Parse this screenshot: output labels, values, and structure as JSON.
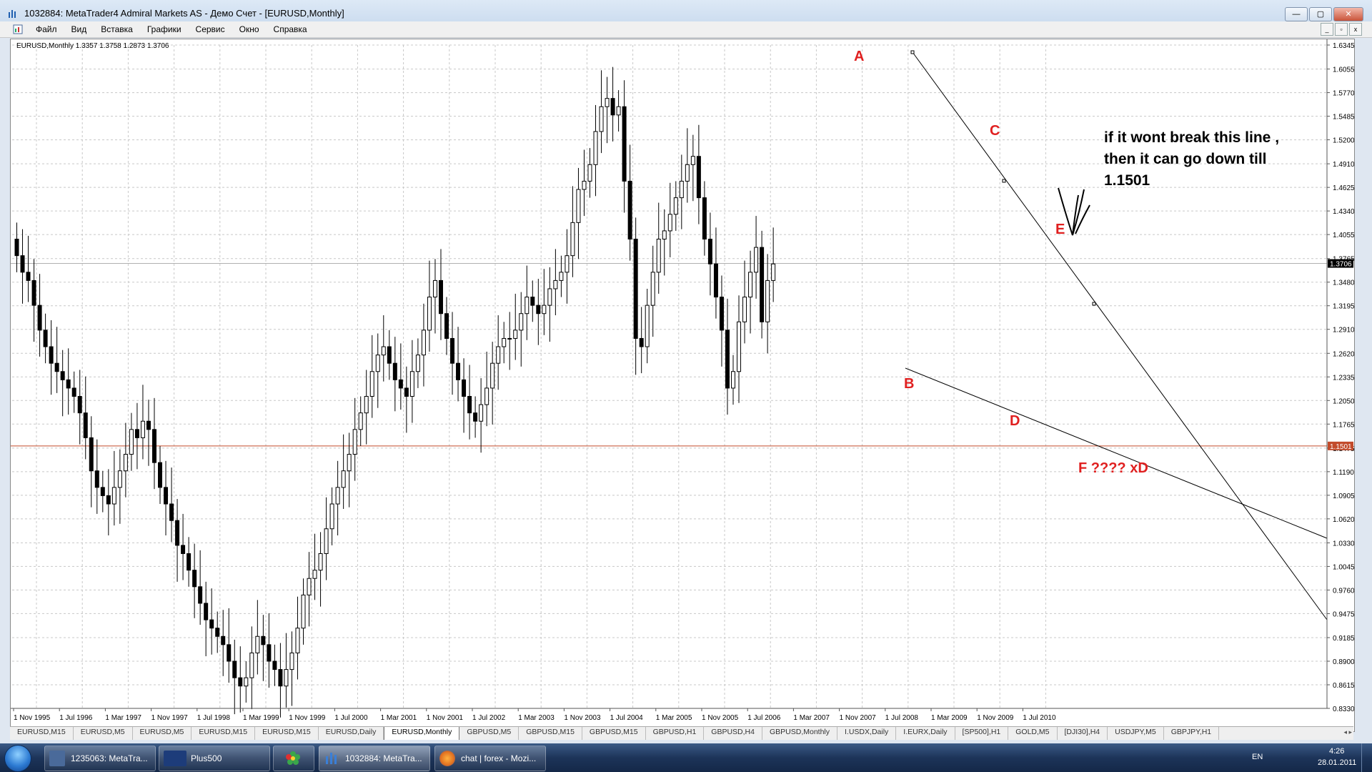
{
  "window": {
    "title": "1032884: MetaTrader4 Admiral Markets AS - Демо Счет - [EURUSD,Monthly]",
    "buttons": [
      "—",
      "▢",
      "✕"
    ]
  },
  "menu": {
    "items": [
      "Файл",
      "Вид",
      "Вставка",
      "Графики",
      "Сервис",
      "Окно",
      "Справка"
    ],
    "mdi_buttons": [
      "_",
      "▫",
      "x"
    ]
  },
  "chart": {
    "header": "EURUSD,Monthly  1.3357 1.3758 1.2873 1.3706",
    "price_labels": [
      "1.6345",
      "1.6055",
      "1.5770",
      "1.5485",
      "1.5200",
      "1.4910",
      "1.4625",
      "1.4340",
      "1.4055",
      "1.3765",
      "1.3480",
      "1.3195",
      "1.2910",
      "1.2620",
      "1.2335",
      "1.2050",
      "1.1765",
      "1.1475",
      "1.1190",
      "1.0905",
      "1.0620",
      "1.0330",
      "1.0045",
      "0.9760",
      "0.9475",
      "0.9185",
      "0.8900",
      "0.8615",
      "0.8330"
    ],
    "price_max": 1.6345,
    "price_min": 0.833,
    "current_price": "1.3706",
    "current_price_value": 1.3706,
    "hline_price": "1.1501",
    "hline_value": 1.1501,
    "date_labels": [
      "1 Nov 1995",
      "1 Jul 1996",
      "1 Mar 1997",
      "1 Nov 1997",
      "1 Jul 1998",
      "1 Mar 1999",
      "1 Nov 1999",
      "1 Jul 2000",
      "1 Mar 2001",
      "1 Nov 2001",
      "1 Jul 2002",
      "1 Mar 2003",
      "1 Nov 2003",
      "1 Jul 2004",
      "1 Mar 2005",
      "1 Nov 2005",
      "1 Jul 2006",
      "1 Mar 2007",
      "1 Nov 2007",
      "1 Jul 2008",
      "1 Mar 2009",
      "1 Nov 2009",
      "1 Jul 2010"
    ],
    "wave_labels": [
      "A",
      "B",
      "C",
      "D",
      "E",
      "F ???? xD"
    ],
    "note_lines": [
      "if it wont break this line ,",
      "then it can go down till",
      "1.1501"
    ]
  },
  "chart_data": {
    "type": "candlestick",
    "symbol": "EURUSD",
    "timeframe": "Monthly",
    "header_ohlc": {
      "open": 1.3357,
      "high": 1.3758,
      "low": 1.2873,
      "close": 1.3706
    },
    "ylim": [
      0.833,
      1.6345
    ],
    "x_range": [
      "1995-11",
      "2011-01"
    ],
    "closes_approx": [
      1.38,
      1.36,
      1.35,
      1.32,
      1.29,
      1.27,
      1.25,
      1.24,
      1.23,
      1.22,
      1.21,
      1.19,
      1.16,
      1.12,
      1.1,
      1.09,
      1.08,
      1.1,
      1.12,
      1.14,
      1.17,
      1.16,
      1.18,
      1.17,
      1.13,
      1.1,
      1.08,
      1.06,
      1.03,
      1.02,
      1.0,
      0.98,
      0.96,
      0.94,
      0.93,
      0.92,
      0.91,
      0.89,
      0.87,
      0.86,
      0.87,
      0.9,
      0.92,
      0.91,
      0.89,
      0.88,
      0.86,
      0.88,
      0.9,
      0.93,
      0.97,
      0.99,
      1.0,
      1.02,
      1.05,
      1.08,
      1.1,
      1.12,
      1.14,
      1.17,
      1.19,
      1.21,
      1.24,
      1.26,
      1.27,
      1.25,
      1.23,
      1.22,
      1.21,
      1.24,
      1.26,
      1.29,
      1.33,
      1.35,
      1.31,
      1.28,
      1.25,
      1.23,
      1.21,
      1.19,
      1.18,
      1.2,
      1.22,
      1.25,
      1.27,
      1.28,
      1.28,
      1.29,
      1.31,
      1.33,
      1.32,
      1.31,
      1.32,
      1.34,
      1.35,
      1.36,
      1.38,
      1.42,
      1.46,
      1.47,
      1.49,
      1.53,
      1.56,
      1.57,
      1.55,
      1.56,
      1.47,
      1.4,
      1.28,
      1.27,
      1.32,
      1.36,
      1.4,
      1.41,
      1.43,
      1.45,
      1.47,
      1.49,
      1.5,
      1.45,
      1.4,
      1.37,
      1.33,
      1.29,
      1.22,
      1.24,
      1.3,
      1.33,
      1.36,
      1.39,
      1.3,
      1.35,
      1.37
    ],
    "annotations": [
      {
        "label": "A",
        "date": "2008-04",
        "price": 1.6
      },
      {
        "label": "B",
        "date": "2008-10",
        "price": 1.24
      },
      {
        "label": "C",
        "date": "2009-11",
        "price": 1.51
      },
      {
        "label": "D",
        "date": "2010-06",
        "price": 1.19
      },
      {
        "label": "E",
        "date": "2010-11",
        "price": 1.42
      }
    ]
  },
  "tabs": [
    "EURUSD,M15",
    "EURUSD,M5",
    "EURUSD,M5",
    "EURUSD,M15",
    "EURUSD,M15",
    "EURUSD,Daily",
    "EURUSD,Monthly",
    "GBPUSD,M5",
    "GBPUSD,M15",
    "GBPUSD,M15",
    "GBPUSD,H1",
    "GBPUSD,H4",
    "GBPUSD,Monthly",
    "I.USDX,Daily",
    "I.EURX,Daily",
    "[SP500],H1",
    "GOLD,M5",
    "[DJI30],H4",
    "USDJPY,M5",
    "GBPJPY,H1"
  ],
  "active_tab": "EURUSD,Monthly",
  "taskbar": {
    "buttons": [
      {
        "label": "1235063: MetaTra...",
        "color": "#4a6a9a"
      },
      {
        "label": "Plus500",
        "color": "#1d3c7a"
      },
      {
        "label": "",
        "color": "#3aa64a"
      },
      {
        "label": "1032884: MetaTra...",
        "color": "#3a7fd8"
      },
      {
        "label": "chat | forex - Mozi...",
        "color": "#e07020"
      }
    ],
    "lang": "EN",
    "time": "4:26",
    "date": "28.01.2011"
  }
}
